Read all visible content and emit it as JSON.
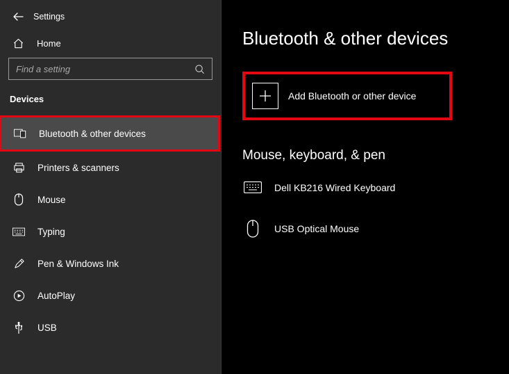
{
  "header": {
    "title": "Settings",
    "home_label": "Home"
  },
  "search": {
    "placeholder": "Find a setting"
  },
  "section_header": "Devices",
  "nav": [
    {
      "label": "Bluetooth & other devices"
    },
    {
      "label": "Printers & scanners"
    },
    {
      "label": "Mouse"
    },
    {
      "label": "Typing"
    },
    {
      "label": "Pen & Windows Ink"
    },
    {
      "label": "AutoPlay"
    },
    {
      "label": "USB"
    }
  ],
  "page": {
    "title": "Bluetooth & other devices",
    "add_label": "Add Bluetooth or other device",
    "section1_title": "Mouse, keyboard, & pen",
    "devices": [
      {
        "name": "Dell KB216 Wired Keyboard"
      },
      {
        "name": "USB Optical Mouse"
      }
    ]
  }
}
